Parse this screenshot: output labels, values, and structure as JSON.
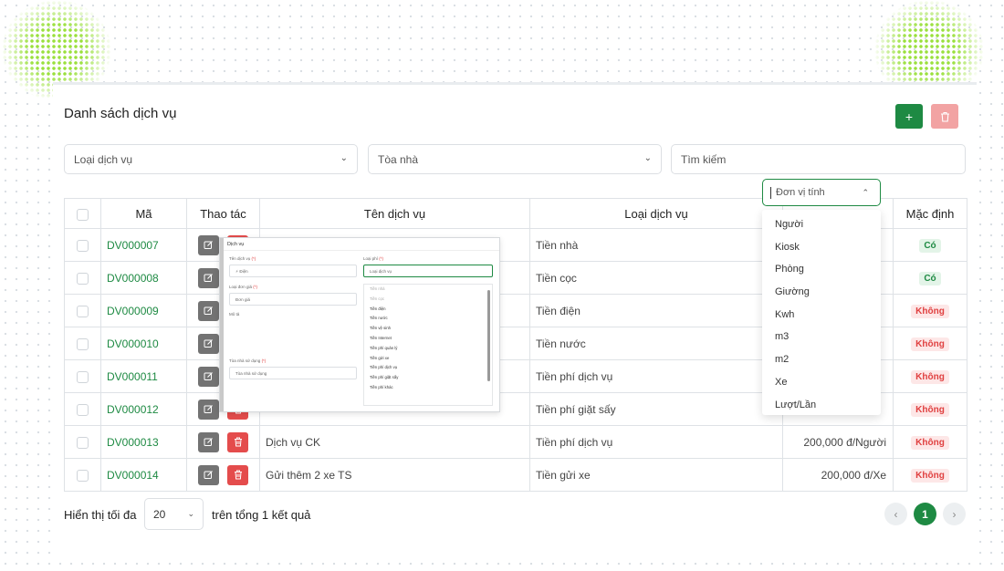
{
  "page": {
    "title": "Danh sách dịch vụ"
  },
  "toolbar": {
    "add_icon": "plus-icon",
    "delete_icon": "trash-icon",
    "add_color": "#1e8a43",
    "delete_color": "#f2a3a3"
  },
  "filters": {
    "service_type_placeholder": "Loại dịch vụ",
    "building_placeholder": "Tòa nhà",
    "search_placeholder": "Tìm kiếm"
  },
  "table": {
    "columns": [
      "Mã",
      "Thao tác",
      "Tên dịch vụ",
      "Loại dịch vụ",
      "Mặc định"
    ],
    "rows": [
      {
        "code": "DV000007",
        "name": "",
        "type": "Tiền nhà",
        "price": "",
        "default": "Có",
        "default_status": "yes"
      },
      {
        "code": "DV000008",
        "name": "",
        "type": "Tiền cọc",
        "price": "",
        "default": "Có",
        "default_status": "yes"
      },
      {
        "code": "DV000009",
        "name": "",
        "type": "Tiền điện",
        "price": "",
        "default": "Không",
        "default_status": "no"
      },
      {
        "code": "DV000010",
        "name": "",
        "type": "Tiền nước",
        "price": "",
        "default": "Không",
        "default_status": "no"
      },
      {
        "code": "DV000011",
        "name": "",
        "type": "Tiền phí dịch vụ",
        "price": "",
        "default": "Không",
        "default_status": "no"
      },
      {
        "code": "DV000012",
        "name": "",
        "type": "Tiền phí giặt sấy",
        "price": "",
        "default": "Không",
        "default_status": "no"
      },
      {
        "code": "DV000013",
        "name": "Dịch vụ CK",
        "type": "Tiền phí dịch vụ",
        "price": "200,000 đ/Người",
        "default": "Không",
        "default_status": "no"
      },
      {
        "code": "DV000014",
        "name": "Gửi thêm 2 xe TS",
        "type": "Tiền gửi xe",
        "price": "200,000 đ/Xe",
        "default": "Không",
        "default_status": "no"
      }
    ]
  },
  "unit_dropdown": {
    "placeholder": "Đơn vị tính",
    "options": [
      "Người",
      "Kiosk",
      "Phòng",
      "Giường",
      "Kwh",
      "m3",
      "m2",
      "Xe",
      "Lượt/Lần"
    ]
  },
  "form_preview": {
    "title": "Dịch vụ",
    "service_name_label": "Tên dịch vụ",
    "service_name_value": "Điện",
    "fee_type_label": "Loại phí",
    "fee_type_placeholder": "Loại dịch vụ",
    "unit_price_type_label": "Loại đơn giá",
    "unit_price_value": "Đơn giá",
    "description_label": "Mô tả",
    "building_label": "Tòa nhà sử dụng",
    "building_placeholder": "Tòa nhà sử dụng",
    "fee_options": [
      "Tiền nhà",
      "Tiền cọc",
      "Tiền điện",
      "Tiền nước",
      "Tiền vệ sinh",
      "Tiền Internet",
      "Tiền phí quản lý",
      "Tiền gửi xe",
      "Tiền phí dịch vụ",
      "Tiền phí giặt sấy",
      "Tiền phí khác"
    ]
  },
  "footer": {
    "show_max_label": "Hiển thị tối đa",
    "page_size": "20",
    "total_label": "trên tổng 1 kết quả",
    "current_page": "1",
    "prev_icon": "chevron-left-icon",
    "next_icon": "chevron-right-icon"
  }
}
